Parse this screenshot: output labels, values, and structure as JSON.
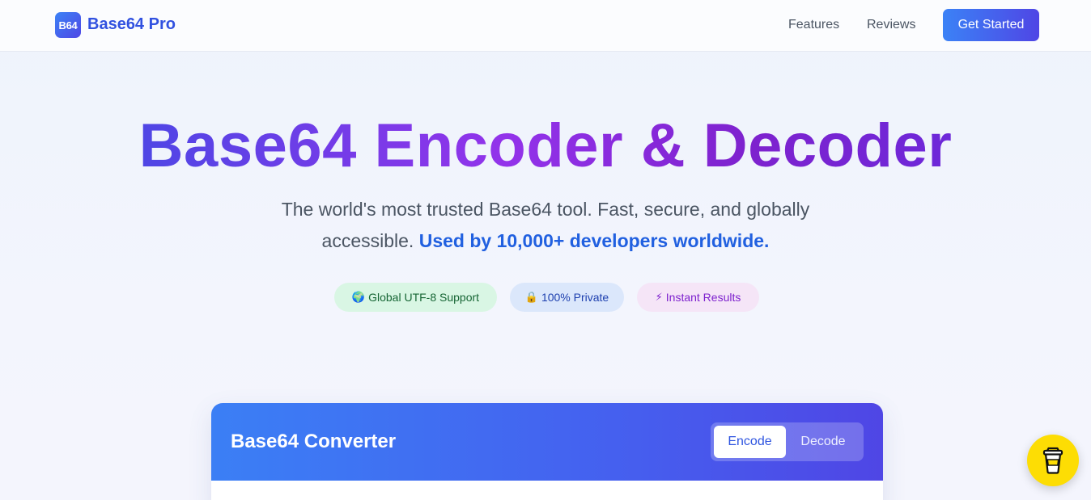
{
  "nav": {
    "logo_badge": "B64",
    "brand": "Base64 Pro",
    "links": [
      "Features",
      "Reviews"
    ],
    "cta": "Get Started"
  },
  "hero": {
    "title": "Base64 Encoder & Decoder",
    "subtitle_plain": "The world's most trusted Base64 tool. Fast, secure, and globally accessible. ",
    "subtitle_highlight": "Used by 10,000+ developers worldwide.",
    "pills": [
      {
        "icon": "🌍",
        "label": "Global UTF-8 Support"
      },
      {
        "icon": "🔒",
        "label": "100% Private"
      },
      {
        "icon": "⚡",
        "label": "Instant Results"
      }
    ]
  },
  "converter": {
    "title": "Base64 Converter",
    "modes": [
      "Encode",
      "Decode"
    ],
    "active_mode": "Encode"
  },
  "fab": {
    "icon": "coffee-cup-icon"
  },
  "colors": {
    "brand_blue": "#3b82f6",
    "brand_indigo": "#4f46e5",
    "highlight": "#2160e0",
    "fab_yellow": "#fddd04"
  }
}
